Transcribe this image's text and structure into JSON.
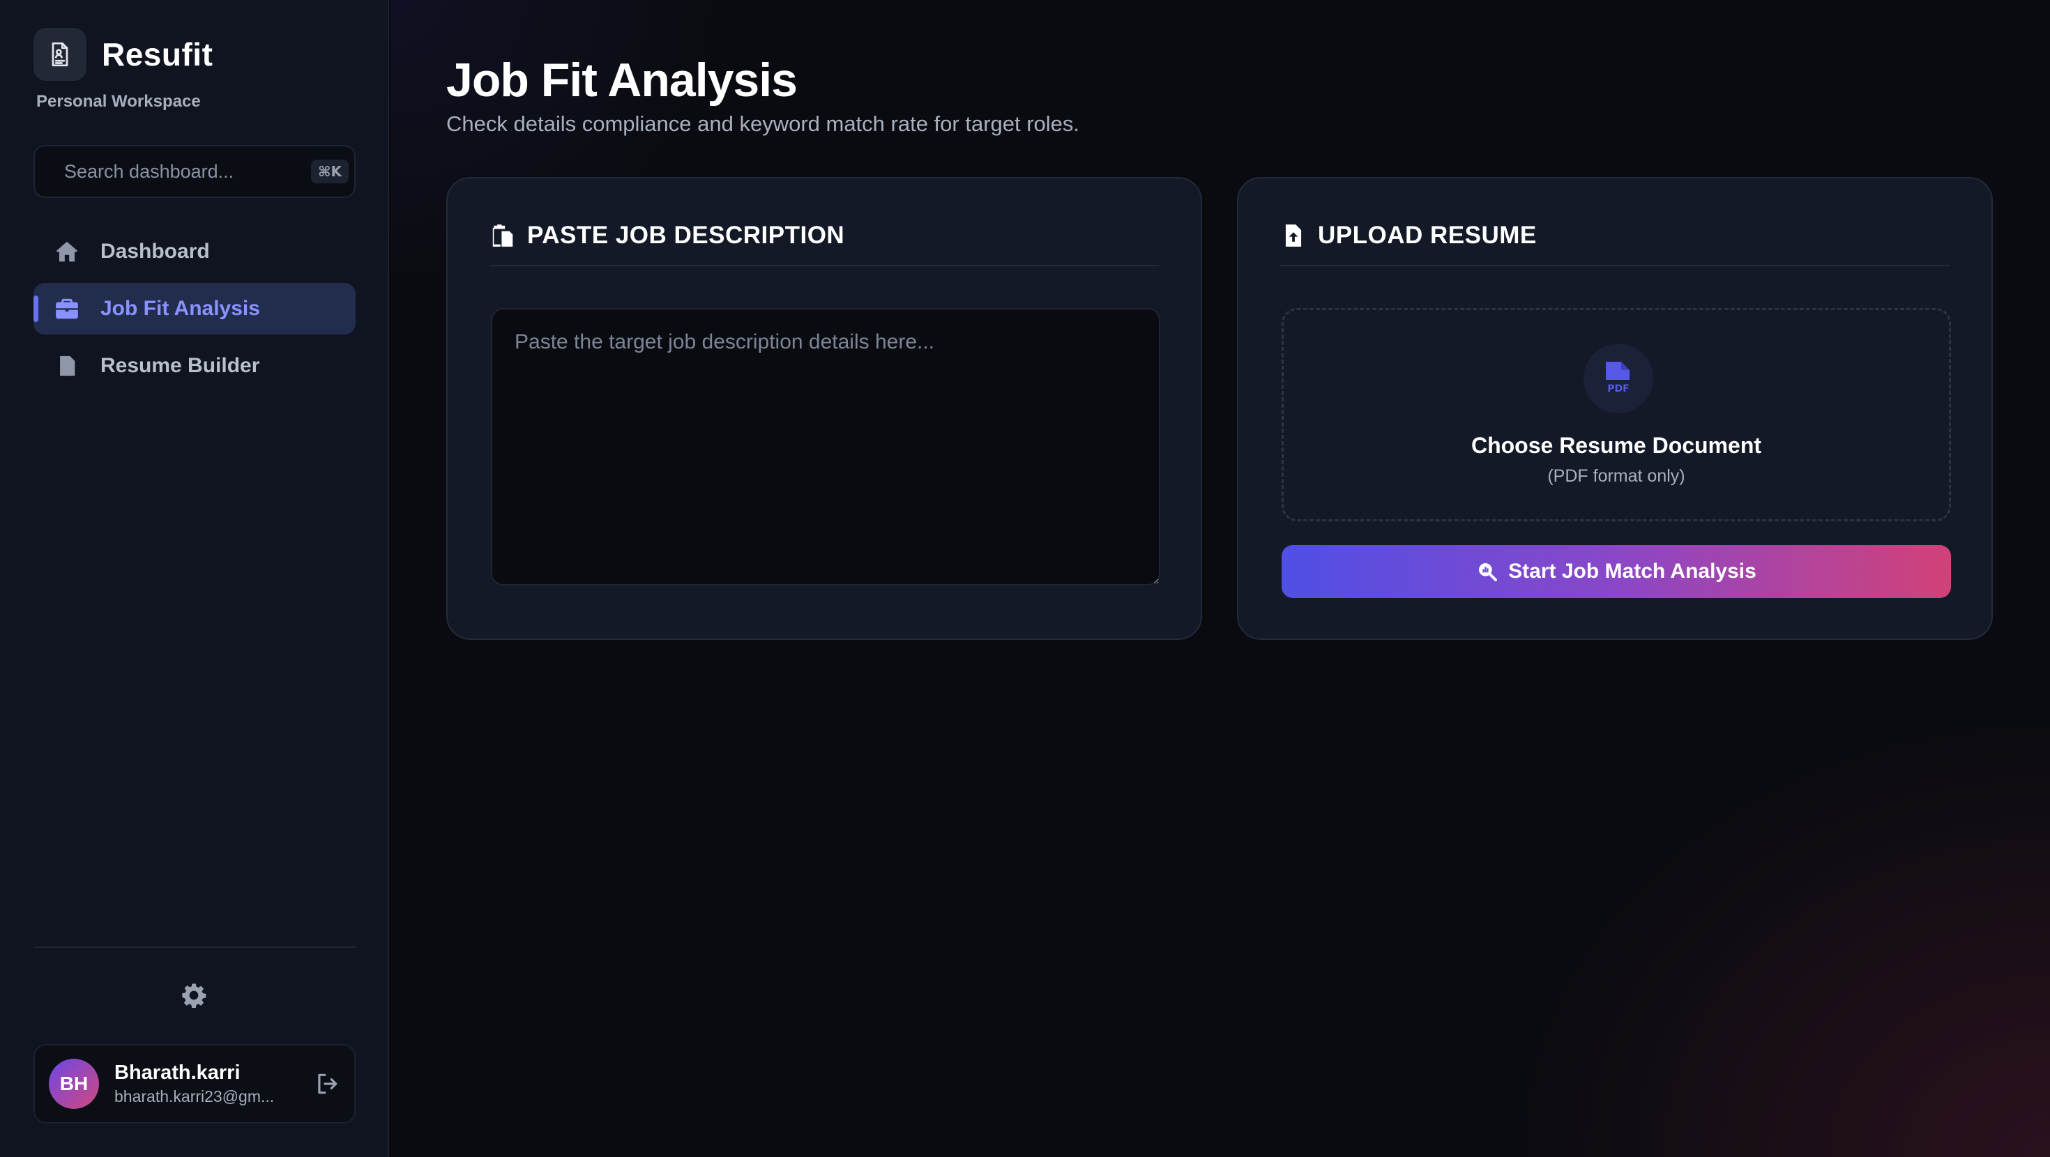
{
  "app": {
    "name": "Resufit",
    "workspace": "Personal Workspace"
  },
  "search": {
    "placeholder": "Search dashboard...",
    "shortcut": "⌘K"
  },
  "sidebar": {
    "items": [
      {
        "label": "Dashboard",
        "icon": "home-icon",
        "active": false
      },
      {
        "label": "Job Fit Analysis",
        "icon": "briefcase-icon",
        "active": true
      },
      {
        "label": "Resume Builder",
        "icon": "document-icon",
        "active": false
      }
    ]
  },
  "user": {
    "initials": "BH",
    "name": "Bharath.karri",
    "email": "bharath.karri23@gm..."
  },
  "page": {
    "title": "Job Fit Analysis",
    "subtitle": "Check details compliance and keyword match rate for target roles."
  },
  "job_card": {
    "title": "PASTE JOB DESCRIPTION",
    "placeholder": "Paste the target job description details here...",
    "value": ""
  },
  "resume_card": {
    "title": "UPLOAD RESUME",
    "upload_title": "Choose Resume Document",
    "upload_note": "(PDF format only)",
    "button_label": "Start Job Match Analysis"
  },
  "colors": {
    "accent": "#6a72f0",
    "active_nav_bg": "#222d4e",
    "gradient_start": "#4f4fe6",
    "gradient_end": "#d24178"
  }
}
